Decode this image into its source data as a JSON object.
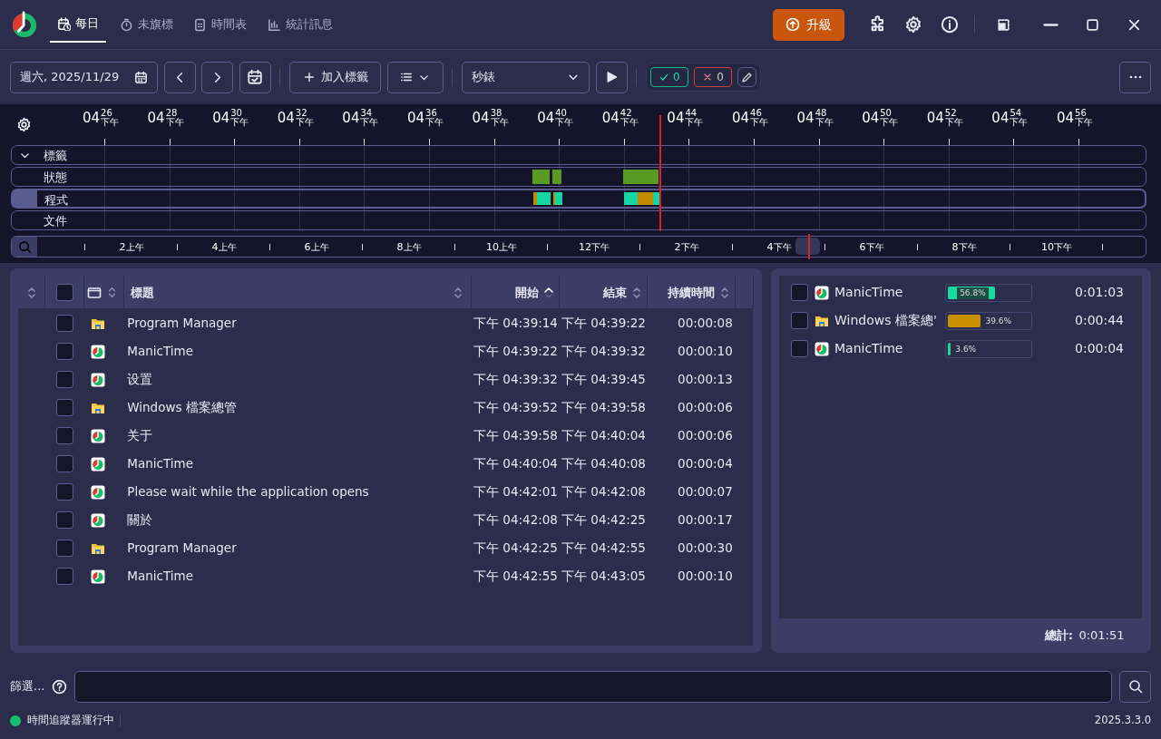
{
  "header": {
    "tabs": [
      {
        "label": "每日",
        "selected": true
      },
      {
        "label": "未旗標",
        "selected": false
      },
      {
        "label": "時間表",
        "selected": false
      },
      {
        "label": "統計訊息",
        "selected": false
      }
    ],
    "upgrade_button": "升級"
  },
  "toolbar": {
    "date": "週六, 2025/11/29",
    "add_tag": "加入標籤",
    "timer_select": "秒錶",
    "approved_count": "0",
    "rejected_count": "0"
  },
  "timeline": {
    "ticks": [
      {
        "hour": "04",
        "minute": "26",
        "ampm": "下午"
      },
      {
        "hour": "04",
        "minute": "28",
        "ampm": "下午"
      },
      {
        "hour": "04",
        "minute": "30",
        "ampm": "下午"
      },
      {
        "hour": "04",
        "minute": "32",
        "ampm": "下午"
      },
      {
        "hour": "04",
        "minute": "34",
        "ampm": "下午"
      },
      {
        "hour": "04",
        "minute": "36",
        "ampm": "下午"
      },
      {
        "hour": "04",
        "minute": "38",
        "ampm": "下午"
      },
      {
        "hour": "04",
        "minute": "40",
        "ampm": "下午"
      },
      {
        "hour": "04",
        "minute": "42",
        "ampm": "下午"
      },
      {
        "hour": "04",
        "minute": "44",
        "ampm": "下午"
      },
      {
        "hour": "04",
        "minute": "46",
        "ampm": "下午"
      },
      {
        "hour": "04",
        "minute": "48",
        "ampm": "下午"
      },
      {
        "hour": "04",
        "minute": "50",
        "ampm": "下午"
      },
      {
        "hour": "04",
        "minute": "52",
        "ampm": "下午"
      },
      {
        "hour": "04",
        "minute": "54",
        "ampm": "下午"
      },
      {
        "hour": "04",
        "minute": "56",
        "ampm": "下午"
      }
    ],
    "rows": [
      {
        "label": "標籤",
        "kind": "group",
        "selected": false
      },
      {
        "label": "狀態",
        "kind": "status",
        "selected": false
      },
      {
        "label": "程式",
        "kind": "apps",
        "selected": true
      },
      {
        "label": "文件",
        "kind": "docs",
        "selected": false
      }
    ],
    "overview_ticks": [
      {
        "hour": "2",
        "ampm": "上午"
      },
      {
        "hour": "4",
        "ampm": "上午"
      },
      {
        "hour": "6",
        "ampm": "上午"
      },
      {
        "hour": "8",
        "ampm": "上午"
      },
      {
        "hour": "10",
        "ampm": "上午"
      },
      {
        "hour": "12",
        "ampm": "下午"
      },
      {
        "hour": "2",
        "ampm": "下午"
      },
      {
        "hour": "4",
        "ampm": "下午"
      },
      {
        "hour": "6",
        "ampm": "下午"
      },
      {
        "hour": "8",
        "ampm": "下午"
      },
      {
        "hour": "10",
        "ampm": "下午"
      }
    ]
  },
  "table": {
    "all_checked": false,
    "columns": [
      {
        "label": "標題",
        "sorted": false
      },
      {
        "label": "開始",
        "sorted": true
      },
      {
        "label": "結束",
        "sorted": false
      },
      {
        "label": "持續時間",
        "sorted": false
      }
    ],
    "rows": [
      {
        "kind": "folder",
        "title": "Program Manager",
        "start": "下午 04:39:14",
        "end": "下午 04:39:22",
        "duration": "00:00:08",
        "checked": false
      },
      {
        "kind": "app",
        "title": "ManicTime",
        "start": "下午 04:39:22",
        "end": "下午 04:39:32",
        "duration": "00:00:10",
        "checked": false
      },
      {
        "kind": "app",
        "title": "设置",
        "start": "下午 04:39:32",
        "end": "下午 04:39:45",
        "duration": "00:00:13",
        "checked": false
      },
      {
        "kind": "folder",
        "title": "Windows 檔案總管",
        "start": "下午 04:39:52",
        "end": "下午 04:39:58",
        "duration": "00:00:06",
        "checked": false
      },
      {
        "kind": "app",
        "title": "关于",
        "start": "下午 04:39:58",
        "end": "下午 04:40:04",
        "duration": "00:00:06",
        "checked": false
      },
      {
        "kind": "app",
        "title": "ManicTime",
        "start": "下午 04:40:04",
        "end": "下午 04:40:08",
        "duration": "00:00:04",
        "checked": false
      },
      {
        "kind": "app",
        "title": "Please wait while the application opens",
        "start": "下午 04:42:01",
        "end": "下午 04:42:08",
        "duration": "00:00:07",
        "checked": false
      },
      {
        "kind": "app",
        "title": "關於",
        "start": "下午 04:42:08",
        "end": "下午 04:42:25",
        "duration": "00:00:17",
        "checked": false
      },
      {
        "kind": "folder",
        "title": "Program Manager",
        "start": "下午 04:42:25",
        "end": "下午 04:42:55",
        "duration": "00:00:30",
        "checked": false
      },
      {
        "kind": "app",
        "title": "ManicTime",
        "start": "下午 04:42:55",
        "end": "下午 04:43:05",
        "duration": "00:00:10",
        "checked": false
      }
    ]
  },
  "summary": {
    "rows": [
      {
        "kind": "app",
        "name": "ManicTime",
        "level": 0.568,
        "percent": "56.8%",
        "duration": "0:01:03",
        "color": "#14dca0",
        "checked": false
      },
      {
        "kind": "folder",
        "name": "Windows 檔案總'",
        "level": 0.396,
        "percent": "39.6%",
        "duration": "0:00:44",
        "color": "#c99000",
        "checked": false
      },
      {
        "kind": "app",
        "name": "ManicTime",
        "level": 0.036,
        "percent": "3.6%",
        "duration": "0:00:04",
        "color": "#14dca0",
        "checked": false
      }
    ],
    "total_label": "總計:",
    "total": "0:01:51"
  },
  "filter": {
    "label": "篩選..."
  },
  "status_bar": {
    "text": "時間追蹤器運行中",
    "running": true,
    "version": "2025.3.3.0"
  }
}
